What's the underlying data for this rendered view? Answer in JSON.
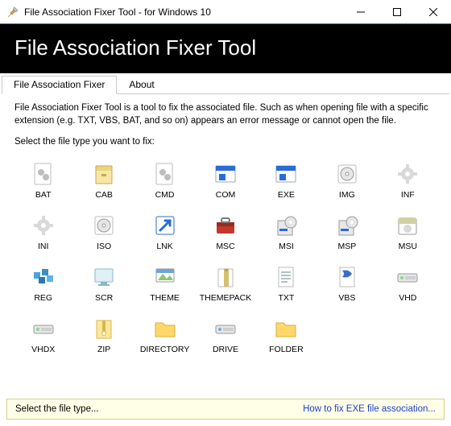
{
  "window": {
    "title": "File Association Fixer Tool - for Windows 10"
  },
  "banner": {
    "heading": "File Association Fixer Tool"
  },
  "tabs": [
    {
      "label": "File Association Fixer",
      "active": true
    },
    {
      "label": "About",
      "active": false
    }
  ],
  "content": {
    "description": "File Association Fixer Tool is a tool to fix the associated file. Such as when opening file with a specific extension (e.g. TXT, VBS, BAT, and so on) appears an error message or cannot open the file.",
    "prompt": "Select the file type you want to fix:"
  },
  "filetypes": [
    {
      "label": "BAT",
      "icon": "gear-doc"
    },
    {
      "label": "CAB",
      "icon": "cabinet"
    },
    {
      "label": "CMD",
      "icon": "gear-doc"
    },
    {
      "label": "COM",
      "icon": "app-blue"
    },
    {
      "label": "EXE",
      "icon": "app-blue"
    },
    {
      "label": "IMG",
      "icon": "disc-box"
    },
    {
      "label": "INF",
      "icon": "gear"
    },
    {
      "label": "INI",
      "icon": "gear"
    },
    {
      "label": "ISO",
      "icon": "disc-box"
    },
    {
      "label": "LNK",
      "icon": "shortcut"
    },
    {
      "label": "MSC",
      "icon": "toolbox"
    },
    {
      "label": "MSI",
      "icon": "installer"
    },
    {
      "label": "MSP",
      "icon": "installer"
    },
    {
      "label": "MSU",
      "icon": "update-box"
    },
    {
      "label": "REG",
      "icon": "reg-blocks"
    },
    {
      "label": "SCR",
      "icon": "scr"
    },
    {
      "label": "THEME",
      "icon": "theme"
    },
    {
      "label": "THEMEPACK",
      "icon": "themepack"
    },
    {
      "label": "TXT",
      "icon": "txt"
    },
    {
      "label": "VBS",
      "icon": "vbs"
    },
    {
      "label": "VHD",
      "icon": "vhd"
    },
    {
      "label": "VHDX",
      "icon": "vhd"
    },
    {
      "label": "ZIP",
      "icon": "zip"
    },
    {
      "label": "DIRECTORY",
      "icon": "folder"
    },
    {
      "label": "DRIVE",
      "icon": "drive"
    },
    {
      "label": "FOLDER",
      "icon": "folder"
    }
  ],
  "status": {
    "left": "Select the file type...",
    "link": "How to fix EXE file association..."
  }
}
